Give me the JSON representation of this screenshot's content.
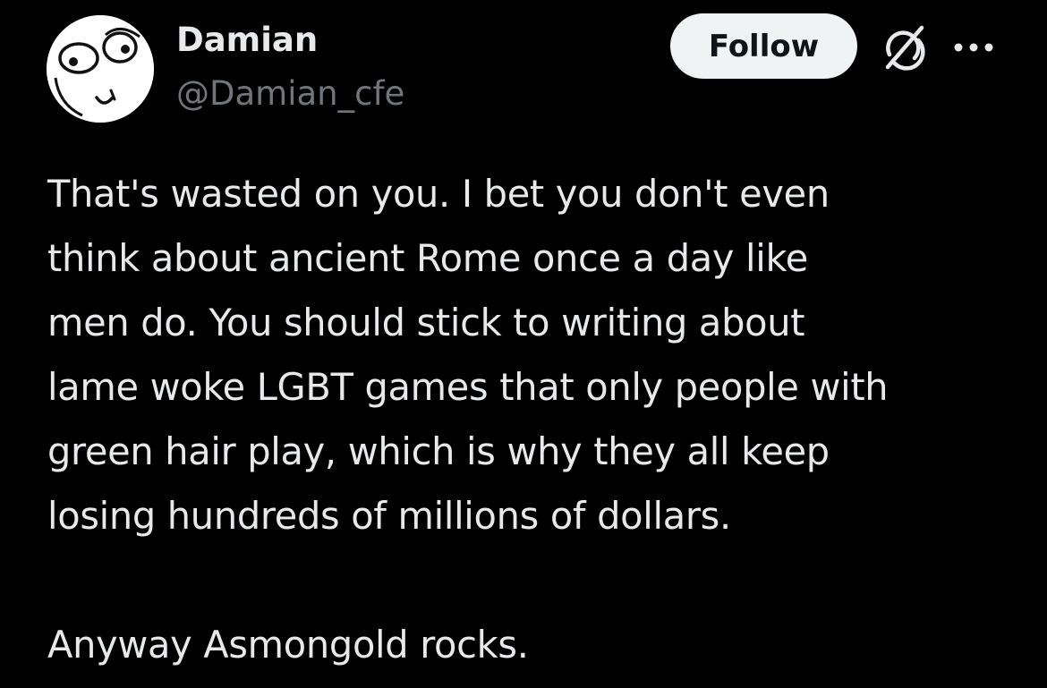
{
  "author": {
    "display_name": "Damian",
    "handle": "@Damian_cfe",
    "avatar_icon": "derp-face-avatar"
  },
  "actions": {
    "follow_label": "Follow",
    "grok_icon": "grok-icon",
    "more_icon": "more-options-icon"
  },
  "tweet": {
    "lines": [
      "That's wasted on you. I bet you don't even",
      "think about ancient Rome once a day like",
      "men do. You should stick to writing about",
      "lame woke LGBT games that only people with",
      "green hair play, which is why they all keep",
      "losing hundreds of millions of dollars."
    ],
    "closing": "Anyway Asmongold rocks."
  },
  "colors": {
    "background": "#000000",
    "text": "#e7e9ea",
    "secondary_text": "#71767b",
    "follow_bg": "#eff3f4",
    "follow_text": "#0f1419"
  }
}
